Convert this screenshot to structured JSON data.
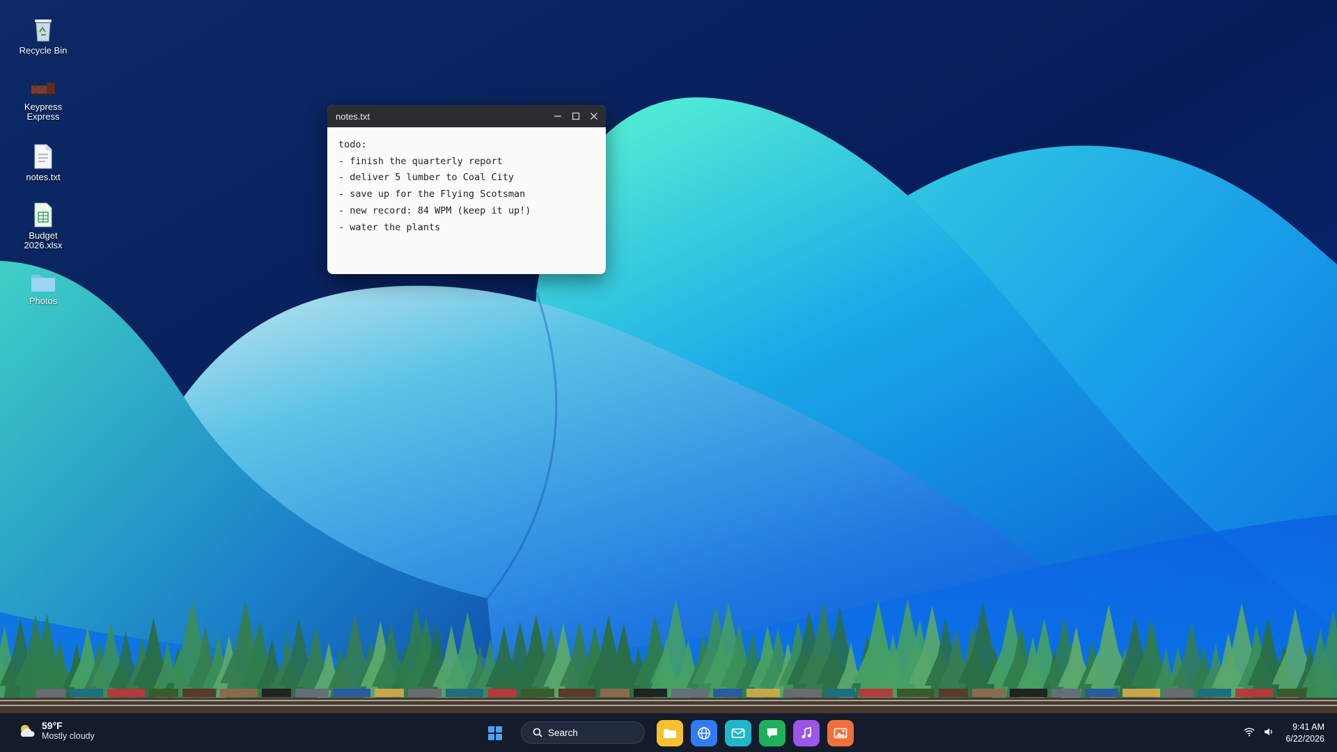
{
  "desktop": {
    "icons": [
      {
        "label": "Recycle Bin",
        "icon": "recycle-bin-icon"
      },
      {
        "label": "Keypress\nExpress",
        "icon": "train-icon"
      },
      {
        "label": "notes.txt",
        "icon": "text-file-icon"
      },
      {
        "label": "Budget\n2026.xlsx",
        "icon": "spreadsheet-icon"
      },
      {
        "label": "Photos",
        "icon": "folder-icon"
      }
    ]
  },
  "notes_window": {
    "title": "notes.txt",
    "content": "todo:\n- finish the quarterly report\n- deliver 5 lumber to Coal City\n- save up for the Flying Scotsman\n- new record: 84 WPM (keep it up!)\n- water the plants"
  },
  "taskbar": {
    "weather": {
      "temp": "59°F",
      "condition": "Mostly cloudy",
      "icon": "partly-cloudy-icon"
    },
    "search_label": "Search",
    "apps": [
      {
        "name": "file-explorer",
        "icon": "folder-icon",
        "color": "#f6c02e"
      },
      {
        "name": "browser",
        "icon": "globe-icon",
        "color": "#2f7df0"
      },
      {
        "name": "mail",
        "icon": "mail-icon",
        "color": "#1fb7c9"
      },
      {
        "name": "messages",
        "icon": "chat-icon",
        "color": "#1fb15a"
      },
      {
        "name": "music",
        "icon": "music-note-icon",
        "color": "#9b55e8"
      },
      {
        "name": "photos",
        "icon": "image-icon",
        "color": "#f0703a"
      }
    ],
    "clock": {
      "time": "9:41 AM",
      "date": "6/22/2026"
    }
  },
  "colors": {
    "wallpaper_dark": "#061a4d",
    "wallpaper_cyan": "#38d2e6",
    "taskbar_bg": "#141b2b",
    "pine": "#2f7d4a"
  }
}
